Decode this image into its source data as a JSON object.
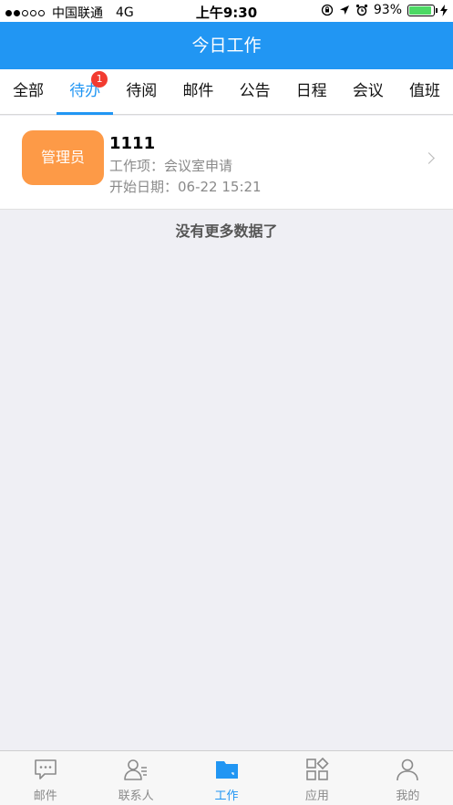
{
  "status_bar": {
    "carrier": "中国联通",
    "network": "4G",
    "time": "上午9:30",
    "battery": "93%"
  },
  "header": {
    "title": "今日工作"
  },
  "tabs": [
    {
      "label": "全部"
    },
    {
      "label": "待办",
      "badge": "1"
    },
    {
      "label": "待阅"
    },
    {
      "label": "邮件"
    },
    {
      "label": "公告"
    },
    {
      "label": "日程"
    },
    {
      "label": "会议"
    },
    {
      "label": "值班"
    }
  ],
  "task": {
    "avatar_label": "管理员",
    "title": "1111",
    "work_item": "工作项：会议室申请",
    "start_date": "开始日期：06-22 15:21"
  },
  "no_more_text": "没有更多数据了",
  "tabbar": [
    {
      "label": "邮件",
      "icon": "chat-bubble-icon"
    },
    {
      "label": "联系人",
      "icon": "contacts-icon"
    },
    {
      "label": "工作",
      "icon": "folder-icon"
    },
    {
      "label": "应用",
      "icon": "apps-grid-icon"
    },
    {
      "label": "我的",
      "icon": "user-icon"
    }
  ],
  "colors": {
    "accent": "#2196f3",
    "avatar": "#fd9a47",
    "badge": "#f23b30"
  }
}
